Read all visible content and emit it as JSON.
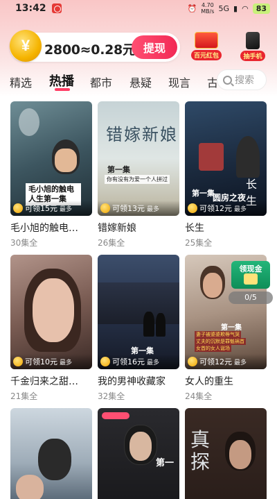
{
  "status_bar": {
    "time": "13:42",
    "net_speed_value": "4.70",
    "net_speed_unit": "MB/s",
    "network": "5G",
    "battery": "83"
  },
  "header": {
    "coin_symbol": "¥",
    "coin_balance": "2800≈0.28元",
    "withdraw_label": "提现",
    "promo_redpacket_label": "百元红包",
    "promo_phone_label": "抽手机"
  },
  "tabs": [
    {
      "label": "精选"
    },
    {
      "label": "热播"
    },
    {
      "label": "都市"
    },
    {
      "label": "悬疑"
    },
    {
      "label": "现言"
    },
    {
      "label": "古"
    }
  ],
  "search": {
    "placeholder": "搜索"
  },
  "dramas": [
    {
      "title": "毛小旭的触电…",
      "episodes": "30集全",
      "reward": "可领15元",
      "reward_suffix": "最多",
      "poster_caption": "毛小旭的触电人生第一集"
    },
    {
      "title": "错嫁新娘",
      "episodes": "26集全",
      "reward": "可领13元",
      "reward_suffix": "最多",
      "poster_big": "错嫁新娘",
      "poster_caption": "第一集",
      "poster_caption2": "你有没有为爱一个人拼过"
    },
    {
      "title": "长生",
      "episodes": "25集全",
      "reward": "可领12元",
      "reward_suffix": "最多",
      "poster_big": "长生",
      "poster_caption": "第一集",
      "poster_caption2": "圆房之夜"
    },
    {
      "title": "千金归来之甜…",
      "episodes": "21集全",
      "reward": "可领10元",
      "reward_suffix": "最多"
    },
    {
      "title": "我的男神收藏家",
      "episodes": "32集全",
      "reward": "可领16元",
      "reward_suffix": "最多",
      "poster_caption": "第一集"
    },
    {
      "title": "女人的重生",
      "episodes": "24集全",
      "reward": "可领12元",
      "reward_suffix": "最多",
      "poster_caption": "第一集",
      "poster_caption2": "妻子被婆婆欺辱气哭",
      "poster_caption3": "丈夫的沉默是罪魁祸首",
      "poster_caption4": "女首的女人诞场"
    },
    {
      "title": "",
      "episodes": "",
      "reward": "",
      "reward_suffix": ""
    },
    {
      "title": "",
      "episodes": "",
      "reward": "",
      "reward_suffix": "",
      "poster_caption": "第一"
    },
    {
      "title": "",
      "episodes": "",
      "reward": "",
      "reward_suffix": "",
      "poster_big": "真探"
    }
  ],
  "promo_card": {
    "label": "领现金",
    "page_indicator": "0/5"
  },
  "colors": {
    "accent": "#ff3b63",
    "withdraw_btn": "#f22a55",
    "header_bg": "#f9c6c6"
  }
}
